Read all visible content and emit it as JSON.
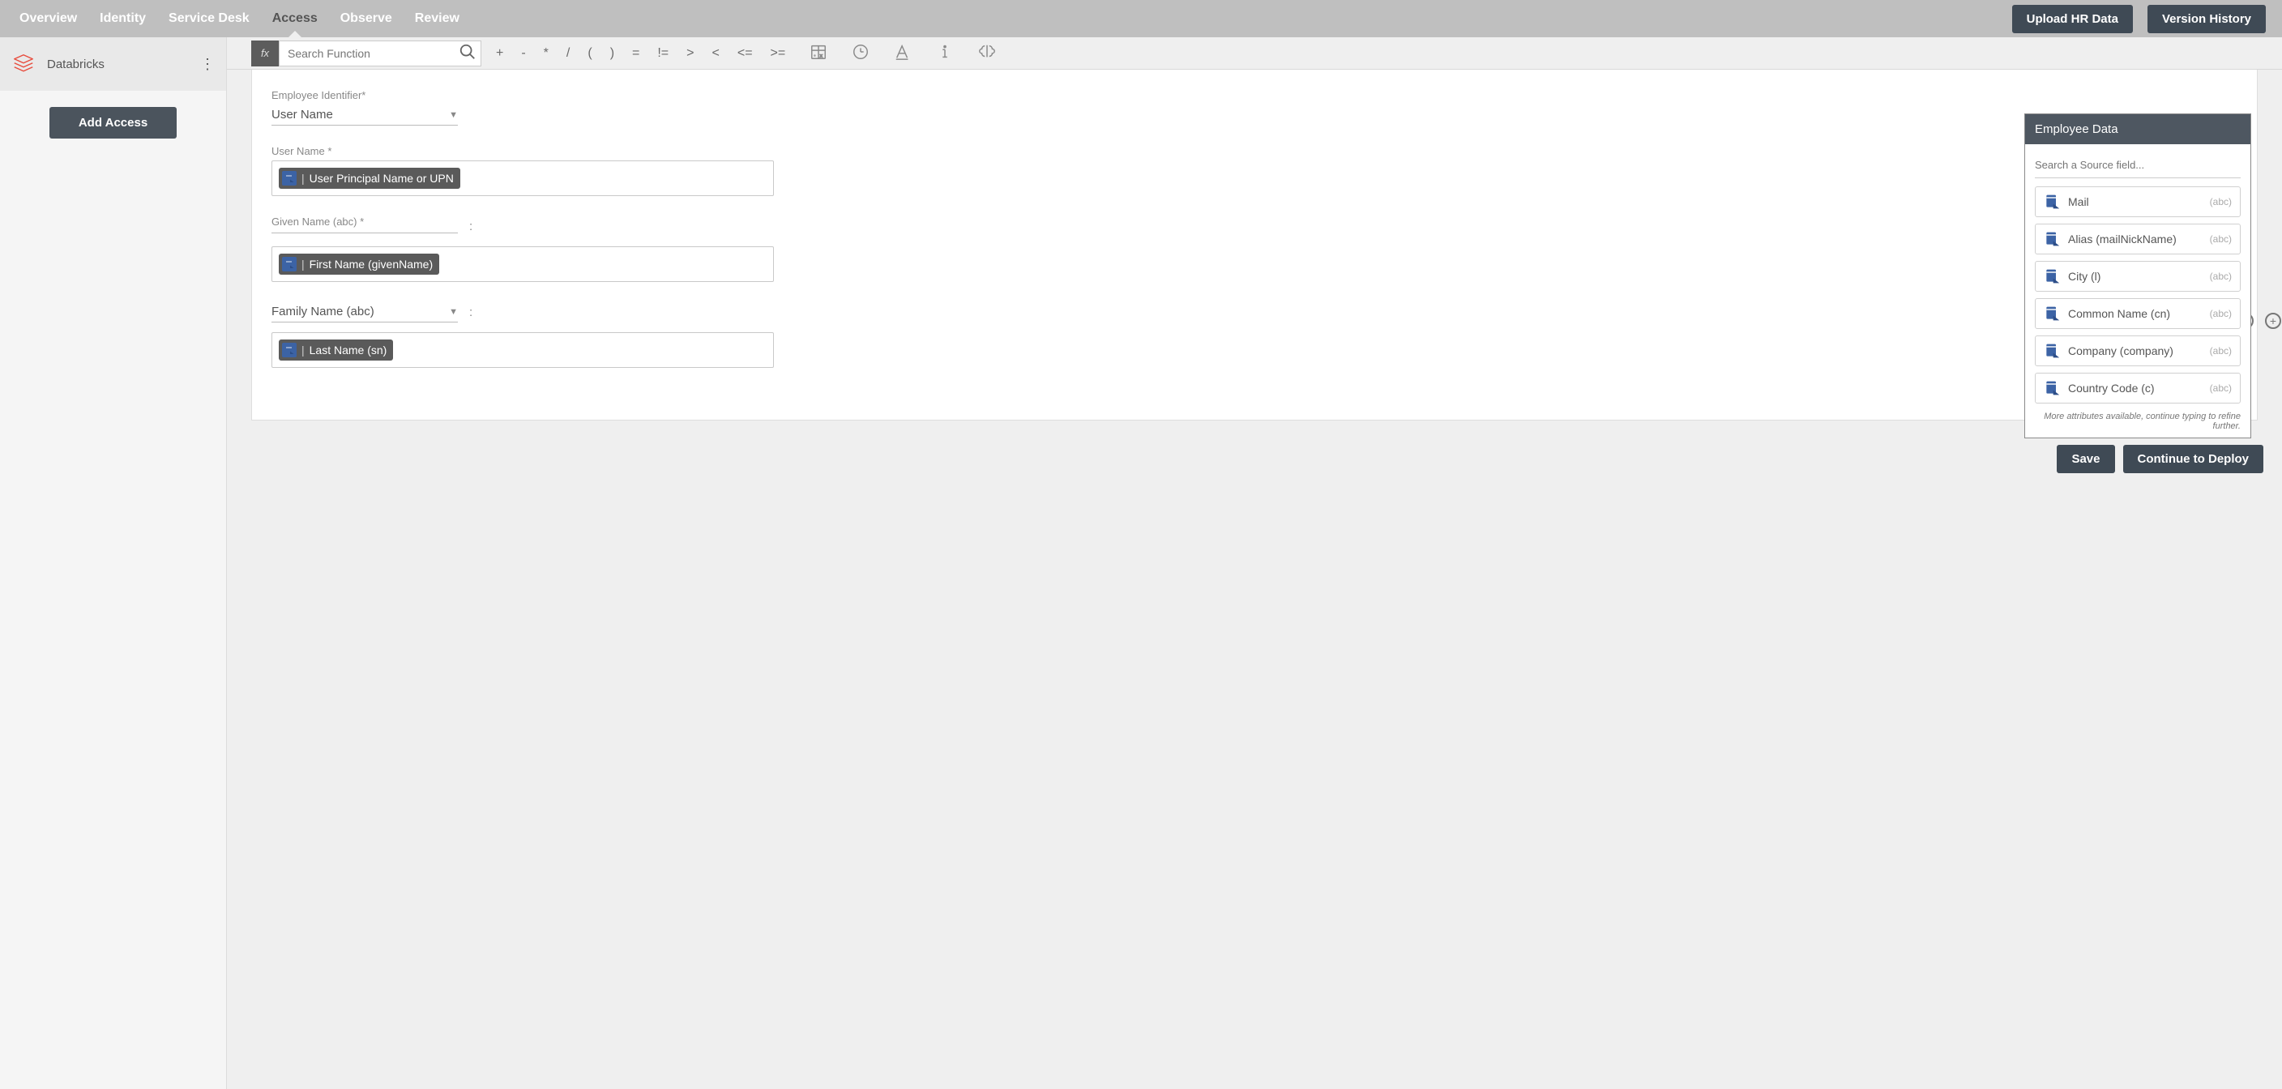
{
  "topnav": {
    "tabs": [
      "Overview",
      "Identity",
      "Service Desk",
      "Access",
      "Observe",
      "Review"
    ],
    "active_index": 3,
    "upload_btn": "Upload HR Data",
    "history_btn": "Version History"
  },
  "sidebar": {
    "app_name": "Databricks",
    "add_access_btn": "Add Access"
  },
  "formula": {
    "fx": "fx",
    "search_placeholder": "Search Function",
    "ops": [
      "+",
      "-",
      "*",
      "/",
      "(",
      ")",
      "=",
      "!=",
      ">",
      "<",
      "<=",
      ">="
    ]
  },
  "form": {
    "emp_id_label": "Employee Identifier*",
    "emp_id_value": "User Name",
    "user_name_label": "User Name *",
    "user_name_chip": "User Principal Name or UPN",
    "given_name_label": "Given Name (abc) *",
    "given_name_colon": ":",
    "given_name_chip": "First Name (givenName)",
    "family_name_label": "Family Name (abc)",
    "family_name_colon": ":",
    "family_name_chip": "Last Name (sn)"
  },
  "palette": {
    "title": "Employee Data",
    "search_placeholder": "Search a Source field...",
    "fields": [
      {
        "name": "Mail",
        "type": "(abc)"
      },
      {
        "name": "Alias (mailNickName)",
        "type": "(abc)"
      },
      {
        "name": "City (l)",
        "type": "(abc)"
      },
      {
        "name": "Common Name (cn)",
        "type": "(abc)"
      },
      {
        "name": "Company (company)",
        "type": "(abc)"
      },
      {
        "name": "Country Code (c)",
        "type": "(abc)"
      }
    ],
    "more_msg": "More attributes available, continue typing to refine further."
  },
  "footer": {
    "save": "Save",
    "deploy": "Continue to Deploy"
  }
}
